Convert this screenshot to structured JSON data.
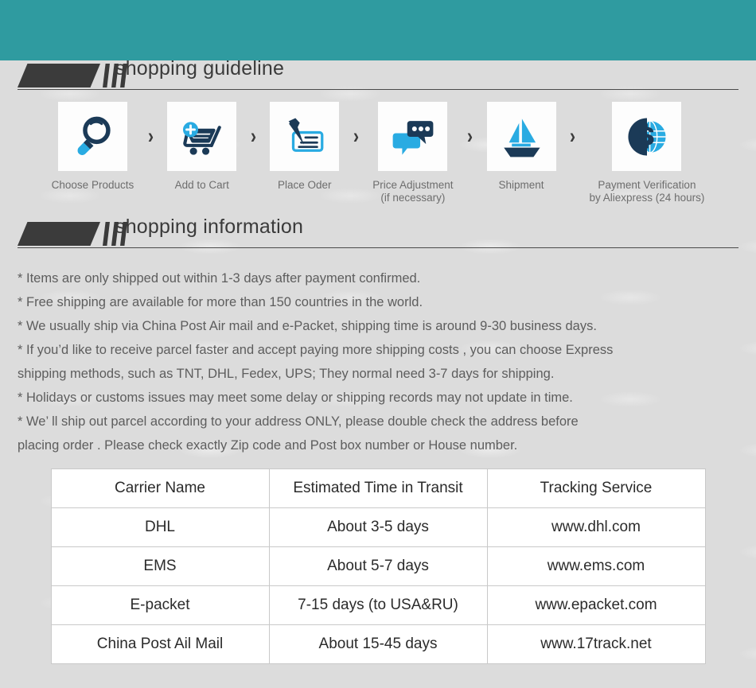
{
  "theme": {
    "header_bar_color": "#2f9ba0",
    "page_background": "#dcdcdc",
    "accent_cyan": "#29abe2",
    "accent_navy": "#1b3a57",
    "tag_dark": "#3b3b3b",
    "body_text": "#5d5d5d",
    "table_border": "#c9c9c9"
  },
  "guideline": {
    "heading": "shopping guideline",
    "steps": [
      {
        "icon": "magnifier-icon",
        "label": "Choose Products"
      },
      {
        "icon": "add-to-cart-icon",
        "label": "Add to Cart"
      },
      {
        "icon": "pen-card-icon",
        "label": "Place Oder"
      },
      {
        "icon": "chat-bubbles-icon",
        "label": "Price Adjustment\n(if necessary)"
      },
      {
        "icon": "sailboat-icon",
        "label": "Shipment"
      },
      {
        "icon": "dollar-globe-icon",
        "label": "Payment Verification\nby  Aliexpress (24 hours)"
      }
    ],
    "separator_icon": "chevron-right-icon",
    "separator_glyph": "›"
  },
  "information": {
    "heading": "shopping information",
    "lines": [
      "* Items are only shipped out within 1-3 days after payment confirmed.",
      "* Free shipping are available for more than 150 countries in the world.",
      "* We usually ship via China Post Air mail and e-Packet, shipping time is around 9-30 business days.",
      "* If you’d like to receive parcel faster and accept paying more shipping costs , you can choose Express\n   shipping methods, such as TNT, DHL, Fedex, UPS; They normal need 3-7 days for shipping.",
      "* Holidays or customs issues may meet some delay or shipping records may not update in time.",
      "* We’ ll ship out parcel according to your address ONLY, please double check the address before\n   placing order . Please check exactly Zip code and Post box number or House number."
    ]
  },
  "shipping_table": {
    "headers": [
      "Carrier Name",
      "Estimated Time in Transit",
      "Tracking Service"
    ],
    "rows": [
      [
        "DHL",
        "About 3-5 days",
        "www.dhl.com"
      ],
      [
        "EMS",
        "About 5-7 days",
        "www.ems.com"
      ],
      [
        "E-packet",
        "7-15 days (to USA&RU)",
        "www.epacket.com"
      ],
      [
        "China Post Ail Mail",
        "About 15-45 days",
        "www.17track.net"
      ]
    ]
  }
}
